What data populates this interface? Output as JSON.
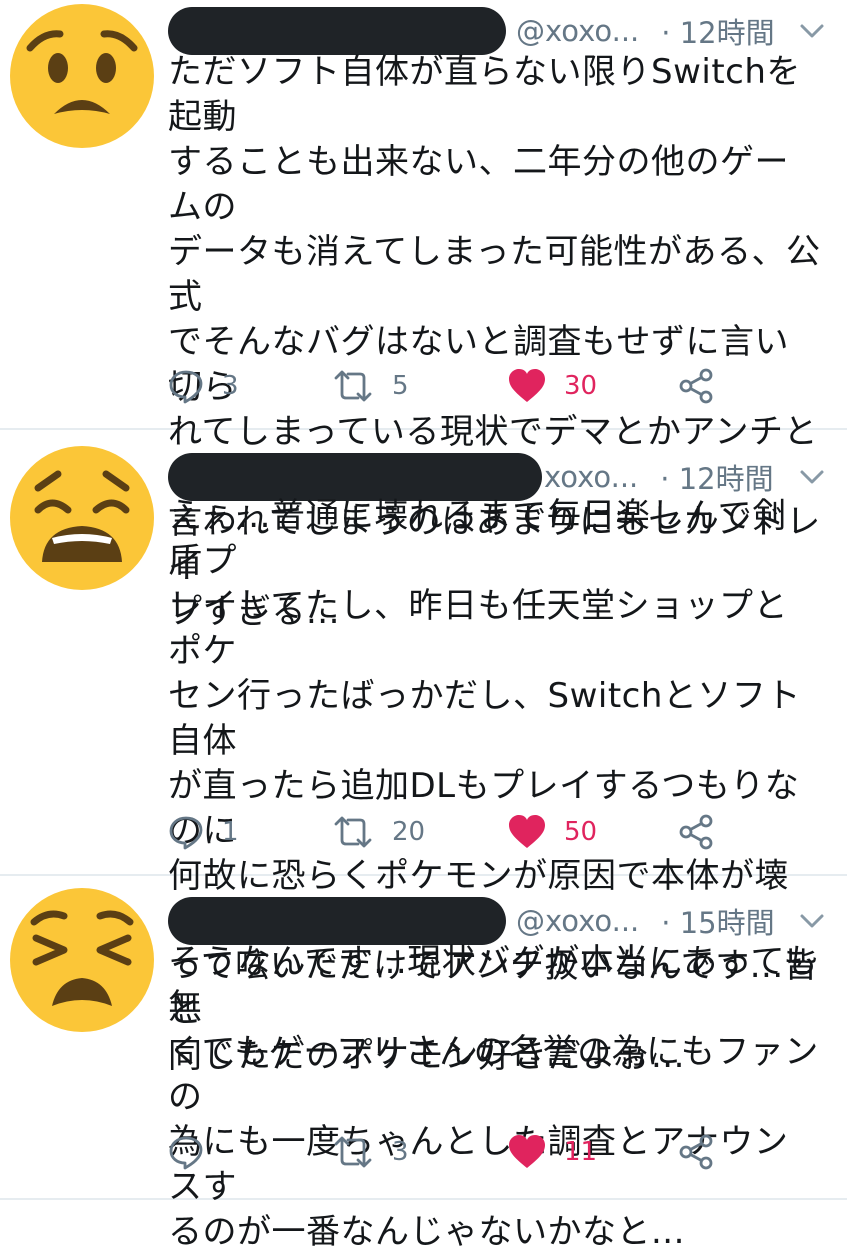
{
  "colors": {
    "text": "#14171a",
    "secondary": "#657786",
    "like": "#e0245e",
    "emoji_face": "#fbc638",
    "emoji_feature": "#5b3f14",
    "divider": "#e6ecf0",
    "redaction": "#1f2327"
  },
  "tweets": [
    {
      "avatar_icon": "worried-face-emoji-icon",
      "handle": "@xoxo...",
      "time": "12時間",
      "text": "ただソフト自体が直らない限りSwitchを起動\nすることも出来ない、二年分の他のゲームの\nデータも消えてしまった可能性がある、公式\nでそんなバグはないと調査もせずに言い切ら\nれてしまっている現状でデマとかアンチとか\n言われてしまうのはあまりにもセカンドレイ\nプすぎる...",
      "replies": "3",
      "retweets": "5",
      "likes": "30"
    },
    {
      "avatar_icon": "weary-face-emoji-icon",
      "handle": "xoxo...",
      "time": "12時間",
      "text": "えぇ...普通に壊れるまで毎日楽しんで剣盾プ\nレイしてたし、昨日も任天堂ショップとポケ\nセン行ったばっかだし、Switchとソフト自体\nが直ったら追加DLもプレイするつもりなのに\n何故に恐らくポケモンが原因で本体が壊れた\nって呟いただけでアンチ扱いなんです...皆と\n同じただのポケモン好きだよぉ...",
      "replies": "1",
      "retweets": "20",
      "likes": "50"
    },
    {
      "avatar_icon": "persevering-face-emoji-icon",
      "handle": "@xoxo...",
      "time": "15時間",
      "text": "そうなんです...現状バグが本当にあっても無\nくてもゲーフリさんの名誉の為にもファンの\n為にも一度ちゃんとした調査とアナウンスす\nるのが一番なんじゃないかなと...",
      "replies": "",
      "retweets": "3",
      "likes": "11"
    }
  ]
}
